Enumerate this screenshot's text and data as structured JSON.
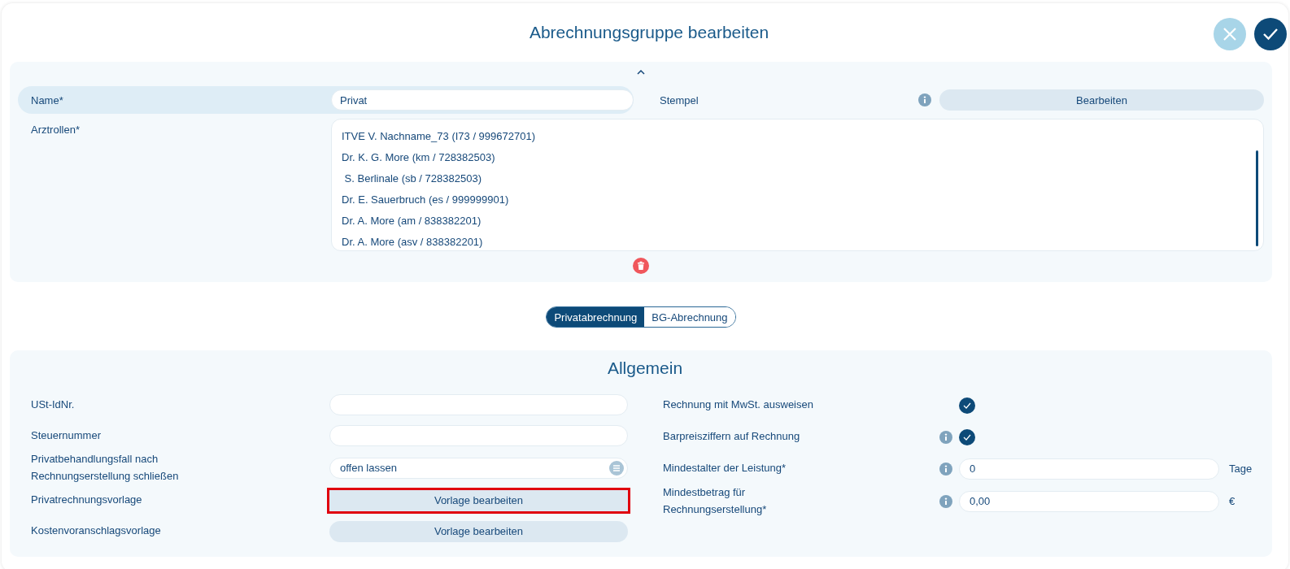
{
  "dialog": {
    "title": "Abrechnungsgruppe bearbeiten"
  },
  "header_panel": {
    "expanded": true,
    "name_label": "Name*",
    "name_value": "Privat",
    "stamp_label": "Stempel",
    "stamp_info": true,
    "stamp_button": "Bearbeiten",
    "roles_label": "Arztrollen*",
    "roles": [
      "ITVE V. Nachname_73 (I73 / 999672701)",
      "Dr. K. G. More (km / 728382503)",
      " S. Berlinale (sb / 728382503)",
      "Dr. E. Sauerbruch (es / 999999901)",
      "Dr. A. More (am / 838382201)",
      "Dr. A. More (asv / 838382201)"
    ]
  },
  "billing_tabs": [
    {
      "label": "Privatabrechnung",
      "selected": true
    },
    {
      "label": "BG-Abrechnung",
      "selected": false
    }
  ],
  "general": {
    "title": "Allgemein",
    "left_rows": [
      {
        "kind": "input",
        "label": "USt-IdNr."
      },
      {
        "kind": "input",
        "label": "Steuernummer"
      },
      {
        "kind": "select",
        "label": "Privatbehandlungsfall nach Rechnungserstellung schließen",
        "value": "offen lassen"
      },
      {
        "kind": "button",
        "label": "Privatrechnungsvorlage",
        "button": "Vorlage bearbeiten",
        "highlighted": true
      },
      {
        "kind": "button",
        "label": "Kostenvoranschlagsvorlage",
        "button": "Vorlage bearbeiten",
        "highlighted": false
      }
    ],
    "right_rows": [
      {
        "kind": "checkbox",
        "label": "Rechnung mit MwSt. ausweisen",
        "info": false,
        "checked": true
      },
      {
        "kind": "checkbox",
        "label": "Barpreisziffern auf Rechnung",
        "info": true,
        "checked": true
      },
      {
        "kind": "input",
        "label": "Mindestalter der Leistung*",
        "info": true,
        "value": "0",
        "unit": "Tage"
      },
      {
        "kind": "input",
        "label": "Mindestbetrag für Rechnungserstellung*",
        "info": true,
        "value": "0,00",
        "unit": "€"
      }
    ]
  }
}
